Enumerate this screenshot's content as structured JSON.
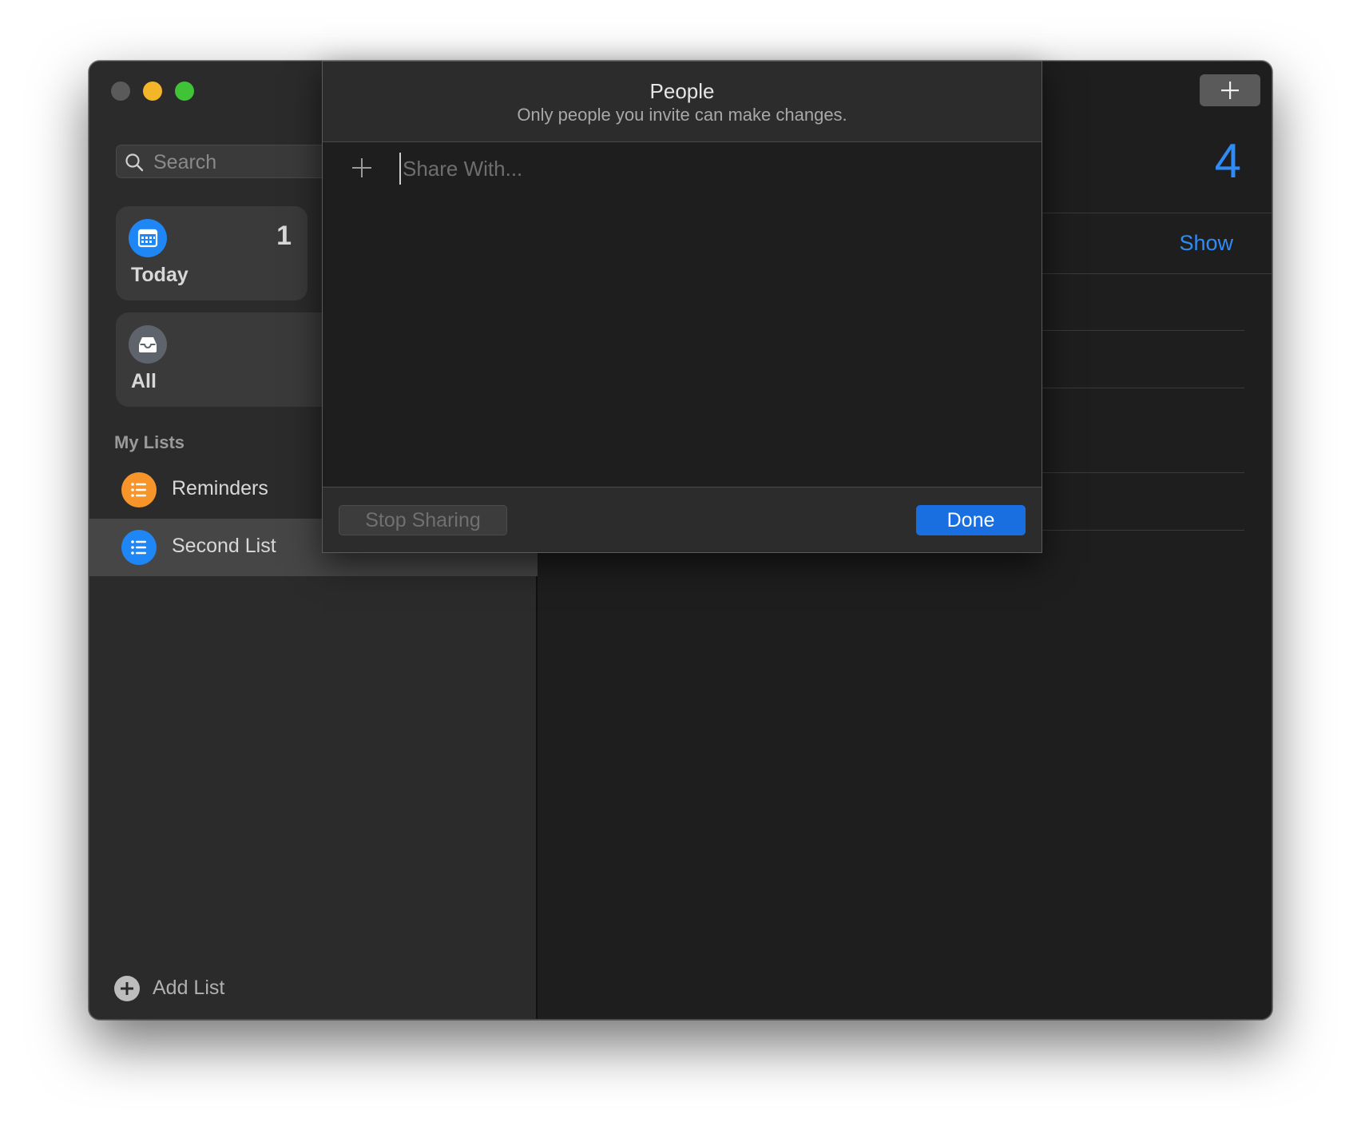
{
  "sidebar": {
    "search": {
      "placeholder": "Search"
    },
    "smart_lists": [
      {
        "label": "Today",
        "count": "1",
        "icon": "calendar-icon",
        "color": "#1f86f5"
      },
      {
        "label": "All",
        "count": "",
        "icon": "tray-icon",
        "color": "#5f646c"
      }
    ],
    "section_title": "My Lists",
    "lists": [
      {
        "label": "Reminders",
        "icon": "list-bullet-icon",
        "color": "#f7952a"
      },
      {
        "label": "Second List",
        "icon": "list-bullet-icon",
        "color": "#1f86f5",
        "selected": true
      }
    ],
    "add_list_label": "Add List"
  },
  "main": {
    "count": "4",
    "show_label": "Show",
    "accent": "#2f8cf6"
  },
  "people_sheet": {
    "title": "People",
    "subtitle": "Only people you invite can make changes.",
    "share_input": {
      "placeholder": "Share With...",
      "value": ""
    },
    "stop_sharing_label": "Stop Sharing",
    "done_label": "Done",
    "done_color": "#1a6fe0"
  }
}
